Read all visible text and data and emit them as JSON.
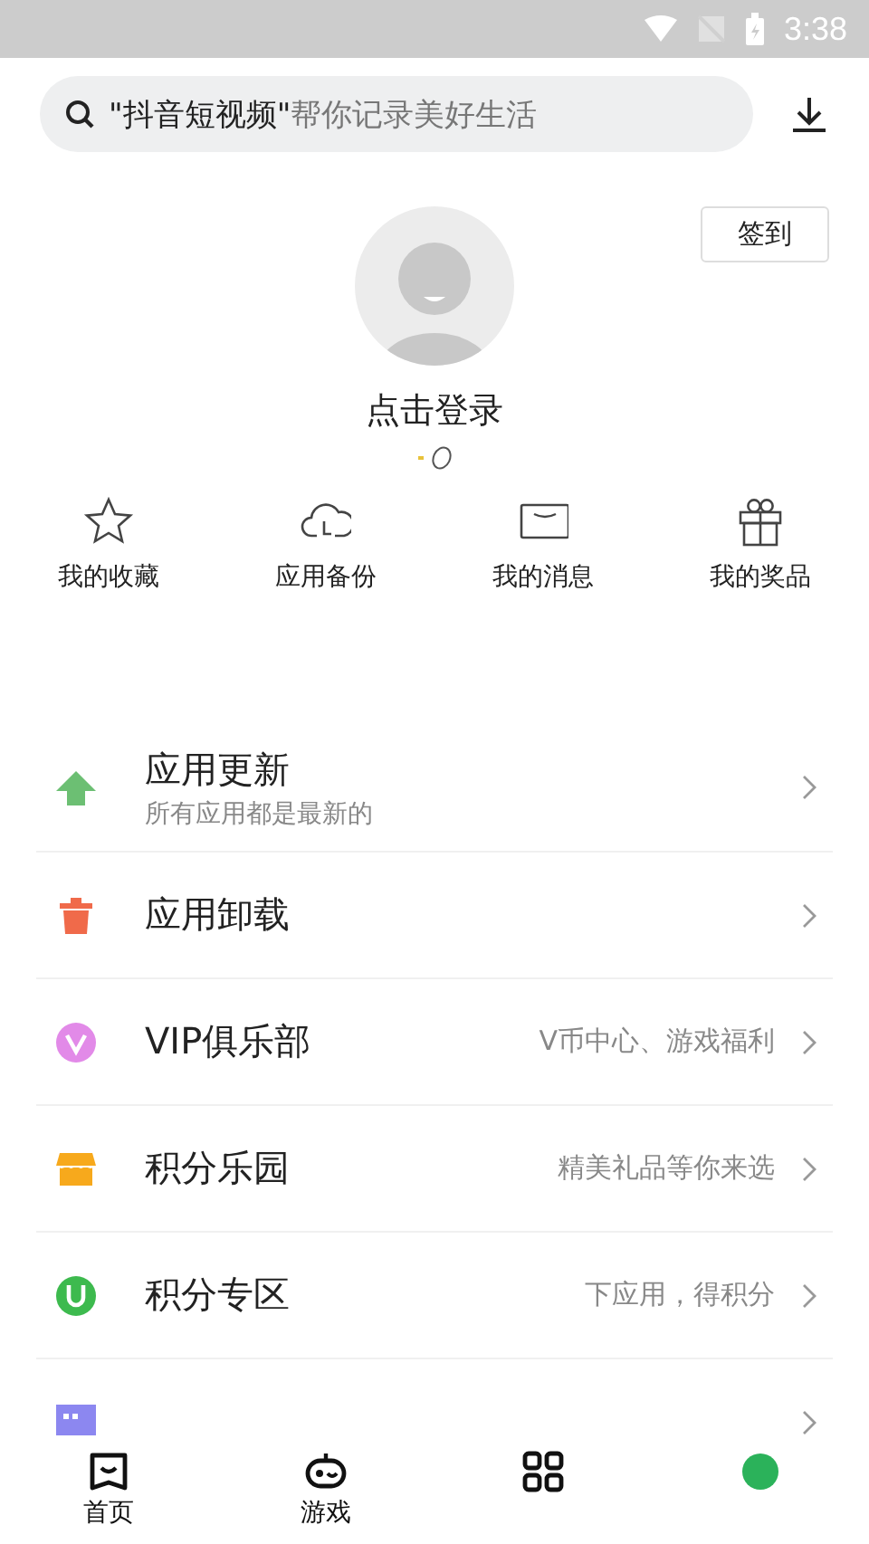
{
  "status_bar": {
    "time": "3:38"
  },
  "search": {
    "placeholder": "**\"抖音短视频\"**帮你记录美好生活"
  },
  "profile": {
    "checkin_button": "签到",
    "login_text": "点击登录"
  },
  "quick_actions": [
    {
      "label": "我的收藏",
      "kind": "star"
    },
    {
      "label": "应用备份",
      "kind": "cloud"
    },
    {
      "label": "我的消息",
      "kind": "mail"
    },
    {
      "label": "我的奖品",
      "kind": "gift"
    }
  ],
  "menu": [
    {
      "kind": "update",
      "color": "#6cbf73",
      "title": "应用更新",
      "subtitle": "所有应用都是最新的"
    },
    {
      "kind": "uninstall",
      "color": "#f06a4a",
      "title": "应用卸载"
    },
    {
      "kind": "vip",
      "color": "#e28ae8",
      "title": "VIP俱乐部",
      "detail": "V币中心、游戏福利"
    },
    {
      "kind": "store",
      "color": "#f7a91c",
      "title": "积分乐园",
      "detail": "精美礼品等你来选"
    },
    {
      "kind": "points",
      "color": "#3dba4e",
      "title": "积分专区",
      "detail": "下应用，得积分"
    },
    {
      "kind": "feedback",
      "color": "#8c87f0"
    }
  ],
  "bottom_nav": [
    {
      "kind": "home",
      "label": "首页"
    },
    {
      "kind": "game",
      "label": "游戏"
    },
    {
      "kind": "grid"
    },
    {
      "kind": "dot"
    }
  ]
}
